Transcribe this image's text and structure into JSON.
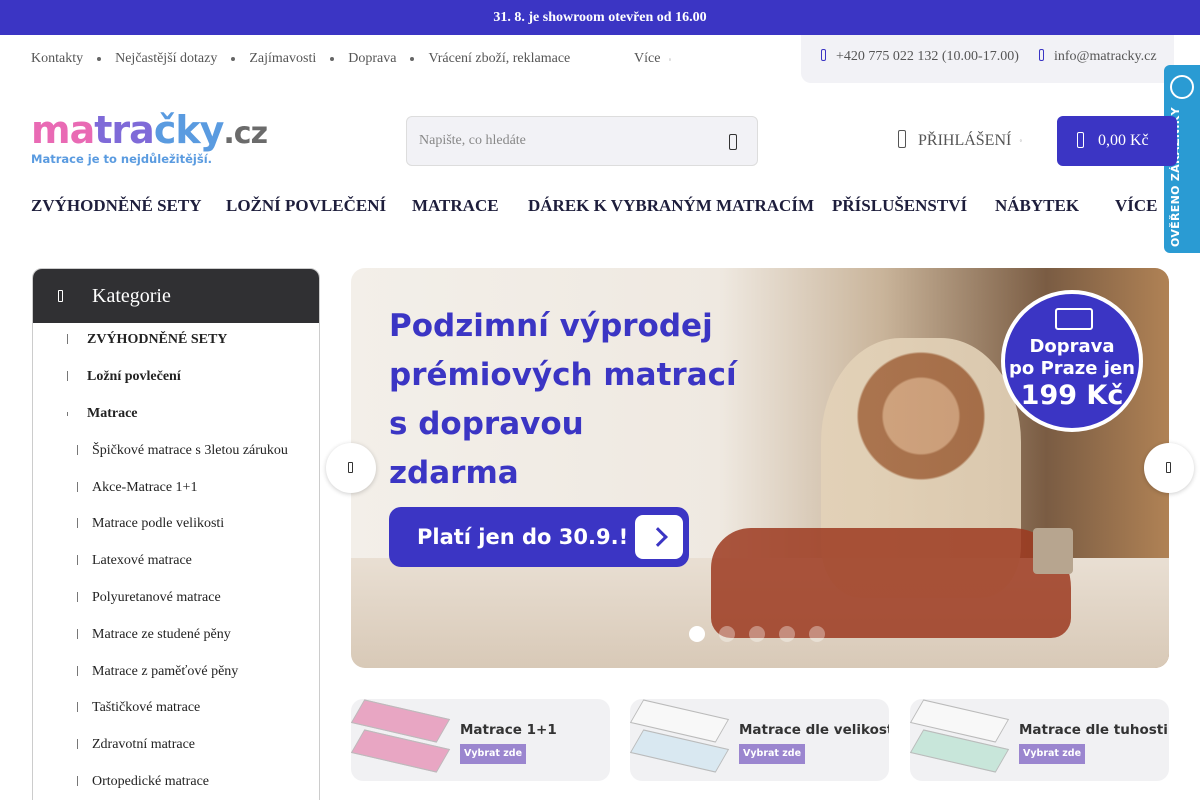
{
  "announcement": "31. 8. je showroom otevřen od 16.00",
  "top_links": [
    "Kontakty",
    "Nejčastější dotazy",
    "Zajímavosti",
    "Doprava",
    "Vrácení zboží, reklamace"
  ],
  "top_more": "Více",
  "contact": {
    "phone": "+420 775 022 132 (10.00-17.00)",
    "email": "info@matracky.cz"
  },
  "verified_badge": "OVĚŘENO ZÁKAZNÍKY",
  "logo": {
    "prefix": "ma",
    "middle": "tra",
    "suffix": "čky",
    "tld": ".cz",
    "tagline": "Matrace je to nejdůležitější."
  },
  "search": {
    "placeholder": "Napište, co hledáte",
    "value": ""
  },
  "login_label": "PŘIHLÁŠENÍ",
  "cart_total": "0,00 Kč",
  "main_nav": [
    "ZVÝHODNĚNÉ SETY",
    "LOŽNÍ POVLEČENÍ",
    "MATRACE",
    "DÁREK K VYBRANÝM MATRACÍM",
    "PŘÍSLUŠENSTVÍ",
    "NÁBYTEK",
    "VÍCE"
  ],
  "categories": {
    "title": "Kategorie",
    "top_items": [
      "ZVÝHODNĚNÉ SETY",
      "Ložní povlečení",
      "Matrace"
    ],
    "sub_items": [
      "Špičkové matrace s 3letou zárukou",
      "Akce-Matrace 1+1",
      "Matrace podle velikosti",
      "Latexové matrace",
      "Polyuretanové matrace",
      "Matrace ze studené pěny",
      "Matrace z paměťové pěny",
      "Taštičkové matrace",
      "Zdravotní matrace",
      "Ortopedické matrace"
    ]
  },
  "banner": {
    "headline_lines": [
      "Podzimní výprodej",
      "prémiových matrací",
      "s dopravou",
      "zdarma"
    ],
    "button_text": "Platí jen do 30.9.!",
    "badge_lines": [
      "Doprava",
      "po Praze jen",
      "199 Kč"
    ],
    "slides_total": 5,
    "active_slide": 1
  },
  "promos": [
    {
      "title": "Matrace 1+1",
      "cta": "Vybrat zde"
    },
    {
      "title": "Matrace dle velikosti",
      "cta": "Vybrat zde"
    },
    {
      "title": "Matrace dle tuhosti",
      "cta": "Vybrat zde"
    }
  ],
  "colors": {
    "brand": "#3b35c4",
    "verified": "#2a9bd3",
    "category_header": "#303033"
  },
  "icons": {
    "phone": "phone-icon",
    "mail": "mail-icon",
    "search": "search-icon",
    "user": "user-icon",
    "cart": "cart-icon",
    "menu": "menu-icon",
    "prev": "chevron-left-icon",
    "next": "chevron-right-icon"
  }
}
